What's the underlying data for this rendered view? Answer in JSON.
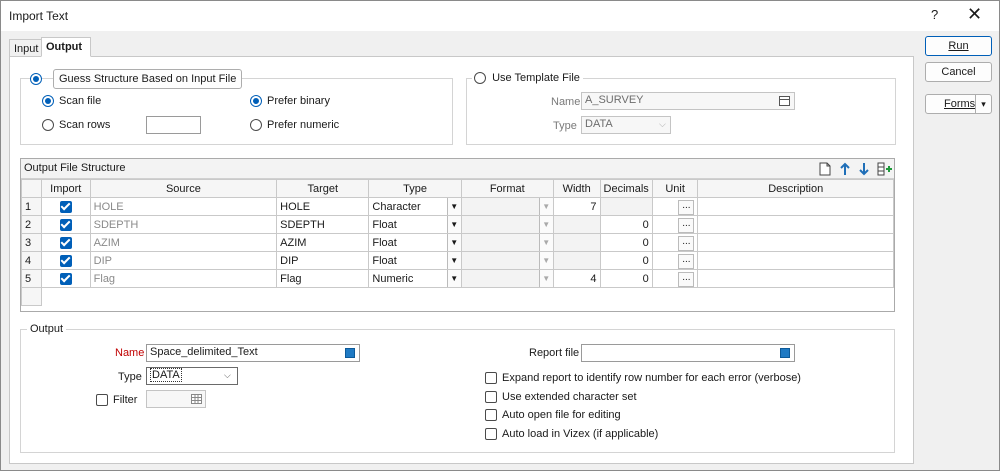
{
  "window": {
    "title": "Import Text",
    "help": "?",
    "close": "✕"
  },
  "tabs": [
    {
      "label": "Input"
    },
    {
      "label": "Output"
    }
  ],
  "buttons": {
    "run": "Run",
    "cancel": "Cancel",
    "forms": "Forms",
    "forms_arrow": "▾"
  },
  "structure": {
    "guess_label": "Guess Structure Based on Input File",
    "guess_selected": true,
    "scan_file": "Scan file",
    "scan_rows": "Scan rows",
    "scan_rows_value": "",
    "prefer_binary": "Prefer binary",
    "prefer_numeric": "Prefer numeric",
    "use_template": "Use Template File",
    "template_name_label": "Name",
    "template_name_value": "A_SURVEY",
    "template_type_label": "Type",
    "template_type_value": "DATA"
  },
  "grid": {
    "title": "Output File Structure",
    "toolbar_icons": [
      "new-file-icon",
      "arrow-up-icon",
      "arrow-down-icon",
      "insert-column-icon"
    ],
    "columns": [
      "",
      "Import",
      "Source",
      "Target",
      "Type",
      "Format",
      "Width",
      "Decimals",
      "Unit",
      "Description"
    ],
    "rows": [
      {
        "n": "1",
        "import": true,
        "source": "HOLE",
        "target": "HOLE",
        "type": "Character",
        "format": "",
        "width": "7",
        "decimals": "",
        "unit": "...",
        "description": ""
      },
      {
        "n": "2",
        "import": true,
        "source": "SDEPTH",
        "target": "SDEPTH",
        "type": "Float",
        "format": "",
        "width": "",
        "decimals": "0",
        "unit": "...",
        "description": ""
      },
      {
        "n": "3",
        "import": true,
        "source": "AZIM",
        "target": "AZIM",
        "type": "Float",
        "format": "",
        "width": "",
        "decimals": "0",
        "unit": "...",
        "description": ""
      },
      {
        "n": "4",
        "import": true,
        "source": "DIP",
        "target": "DIP",
        "type": "Float",
        "format": "",
        "width": "",
        "decimals": "0",
        "unit": "...",
        "description": ""
      },
      {
        "n": "5",
        "import": true,
        "source": "Flag",
        "target": "Flag",
        "type": "Numeric",
        "format": "",
        "width": "4",
        "decimals": "0",
        "unit": "...",
        "description": ""
      }
    ]
  },
  "output": {
    "group_label": "Output",
    "name_label": "Name",
    "name_value": "Space_delimited_Text",
    "type_label": "Type",
    "type_value": "DATA",
    "filter_label": "Filter",
    "filter_checked": false,
    "report_label": "Report file",
    "report_value": "",
    "options": [
      {
        "label": "Expand report to identify row number for each error (verbose)",
        "checked": false
      },
      {
        "label": "Use extended character set",
        "checked": false
      },
      {
        "label": "Auto open file for editing",
        "checked": false
      },
      {
        "label": "Auto load in Vizex (if applicable)",
        "checked": false
      }
    ]
  },
  "colors": {
    "accent": "#005fb8",
    "required_label": "#c00000",
    "file_icon": "#1f7ac4"
  }
}
